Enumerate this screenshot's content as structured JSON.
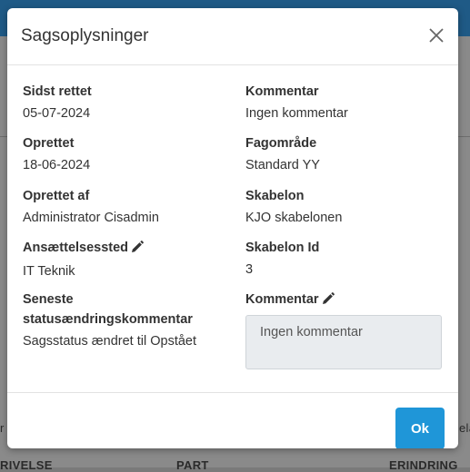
{
  "background": {
    "left_text": "r",
    "right_text": "ela",
    "col1": "RIVELSE",
    "col2": "PART",
    "col3": "ERINDRING"
  },
  "modal": {
    "title": "Sagsoplysninger",
    "fields_left": [
      {
        "label": "Sidst rettet",
        "value": "05-07-2024"
      },
      {
        "label": "Oprettet",
        "value": "18-06-2024"
      },
      {
        "label": "Oprettet af",
        "value": "Administrator Cisadmin"
      },
      {
        "label": "Ansættelsessted",
        "value": "IT Teknik",
        "editable": true
      },
      {
        "label": "Seneste statusændringskommentar",
        "value": "Sagsstatus ændret til Opstået"
      }
    ],
    "fields_right": [
      {
        "label": "Kommentar",
        "value": "Ingen kommentar"
      },
      {
        "label": "Fagområde",
        "value": "Standard YY"
      },
      {
        "label": "Skabelon",
        "value": "KJO skabelonen"
      },
      {
        "label": "Skabelon Id",
        "value": "3"
      },
      {
        "label": "Kommentar",
        "editable": true,
        "placeholder": "Ingen kommentar"
      }
    ],
    "ok_label": "Ok"
  },
  "colors": {
    "accent": "#1f96d8",
    "topbar": "#1f5a86"
  }
}
